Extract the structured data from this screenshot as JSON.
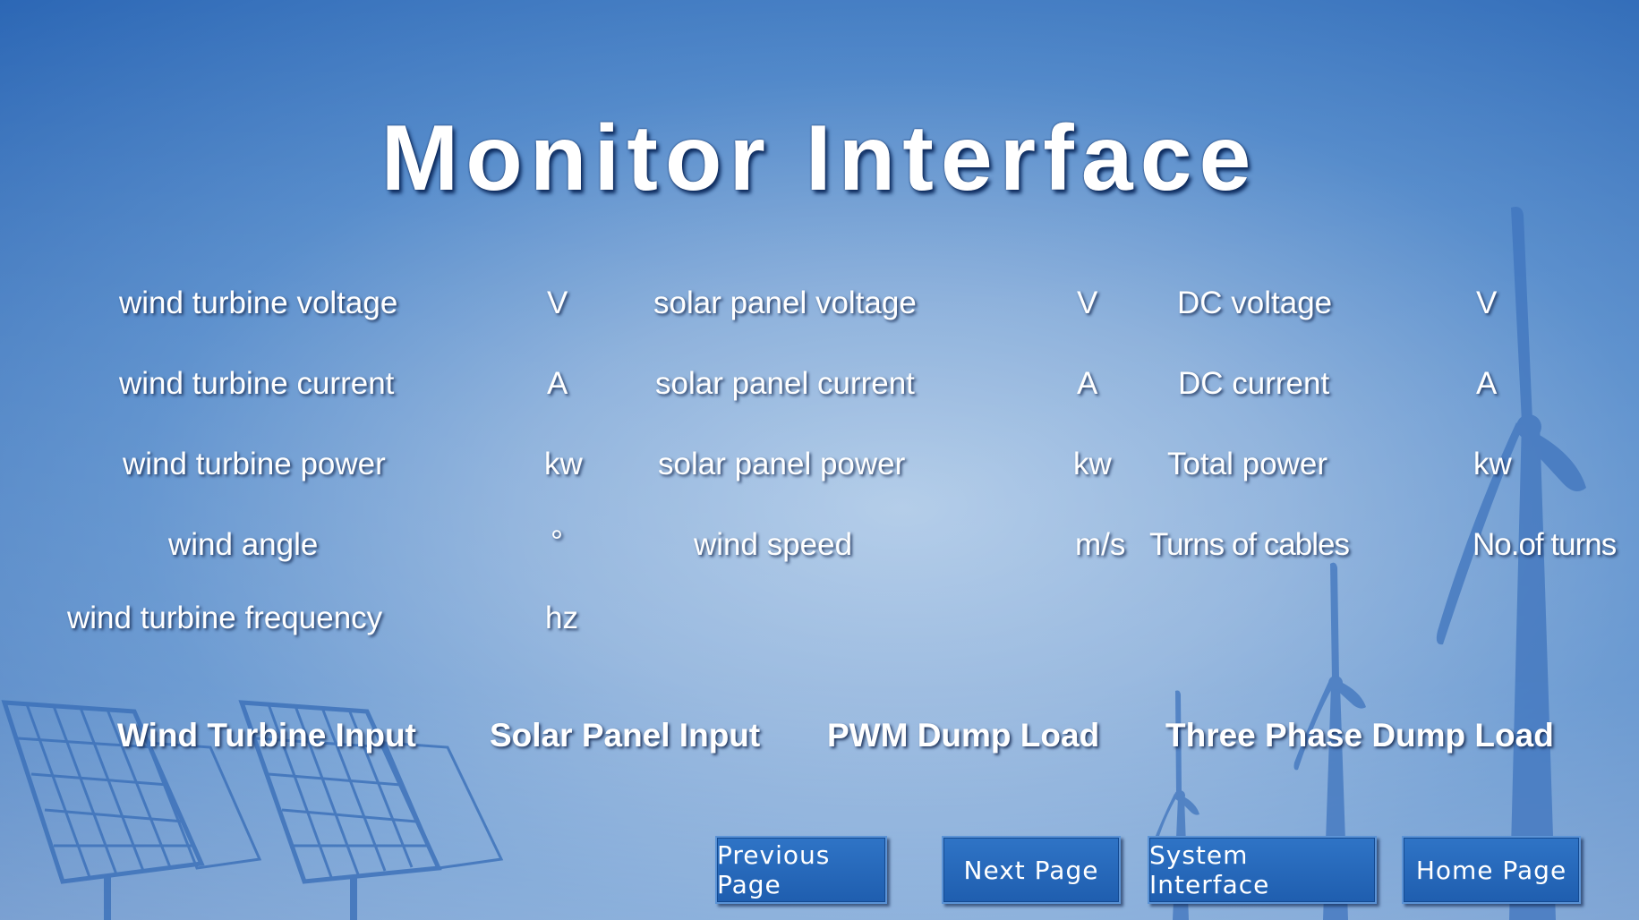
{
  "title": "Monitor Interface",
  "rows": {
    "wt_voltage": {
      "label": "wind turbine voltage",
      "unit": "V"
    },
    "wt_current": {
      "label": "wind turbine current",
      "unit": "A"
    },
    "wt_power": {
      "label": "wind turbine power",
      "unit": "kw"
    },
    "wind_angle": {
      "label": "wind angle",
      "unit": "°"
    },
    "wt_frequency": {
      "label": "wind turbine frequency",
      "unit": "hz"
    },
    "sp_voltage": {
      "label": "solar panel voltage",
      "unit": "V"
    },
    "sp_current": {
      "label": "solar panel current",
      "unit": "A"
    },
    "sp_power": {
      "label": "solar panel power",
      "unit": "kw"
    },
    "wind_speed": {
      "label": "wind speed",
      "unit": "m/s"
    },
    "dc_voltage": {
      "label": "DC voltage",
      "unit": "V"
    },
    "dc_current": {
      "label": "DC current",
      "unit": "A"
    },
    "total_power": {
      "label": "Total power",
      "unit": "kw"
    },
    "turns_cables": {
      "label": "Turns of cables",
      "unit": "No.of turns"
    }
  },
  "inputs": {
    "wind_turbine": "Wind Turbine Input",
    "solar_panel": "Solar Panel Input",
    "pwm_dump": "PWM Dump Load",
    "three_phase_dump": "Three Phase Dump Load"
  },
  "nav": {
    "previous": "Previous Page",
    "next": "Next Page",
    "system": "System Interface",
    "home": "Home Page"
  },
  "colors": {
    "background": "#4f87c9",
    "button": "#2f74c6",
    "text": "#ffffff"
  },
  "icons": {
    "solar_panels": "solar-panels-illustration",
    "wind_turbines": "wind-turbines-illustration"
  }
}
